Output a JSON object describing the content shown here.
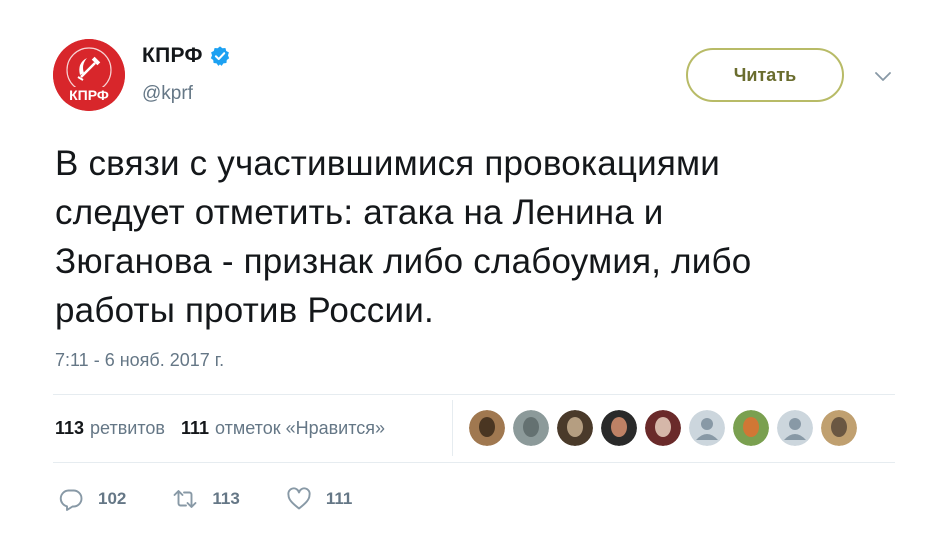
{
  "author": {
    "display_name": "КПРФ",
    "handle": "@kprf",
    "avatar_text": "КПРФ",
    "verified": true
  },
  "follow_button": {
    "label": "Читать"
  },
  "tweet": {
    "lines": [
      "В связи с участившимися провокациями",
      "следует отметить: атака на Ленина и",
      "Зюганова - признак либо слабоумия, либо",
      "работы против России."
    ],
    "timestamp": "7:11 - 6 нояб. 2017 г."
  },
  "stats": {
    "retweets_count": "113",
    "retweets_label": "ретвитов",
    "likes_count": "111",
    "likes_label": "отметок «Нравится»"
  },
  "likers": [
    {
      "color": "#a07850",
      "accent": "#3b2a1a"
    },
    {
      "color": "#8c9a9a",
      "accent": "#5d6a6a"
    },
    {
      "color": "#4a3a2a",
      "accent": "#c8b090"
    },
    {
      "color": "#2a2a2a",
      "accent": "#d89070"
    },
    {
      "color": "#6a2a2a",
      "accent": "#e8d0c0"
    },
    {
      "color": "#ccd6dd",
      "accent": "#8899a6",
      "default": true
    },
    {
      "color": "#7aa050",
      "accent": "#e07030"
    },
    {
      "color": "#ccd6dd",
      "accent": "#8899a6",
      "default": true
    },
    {
      "color": "#c0a070",
      "accent": "#5a4a3a"
    }
  ],
  "actions": {
    "reply_count": "102",
    "retweet_count": "113",
    "like_count": "111"
  },
  "colors": {
    "text_primary": "#14171a",
    "text_secondary": "#657786",
    "verified_blue": "#1da1f2",
    "follow_border": "#b8bb67",
    "brand_red": "#d8262b"
  }
}
